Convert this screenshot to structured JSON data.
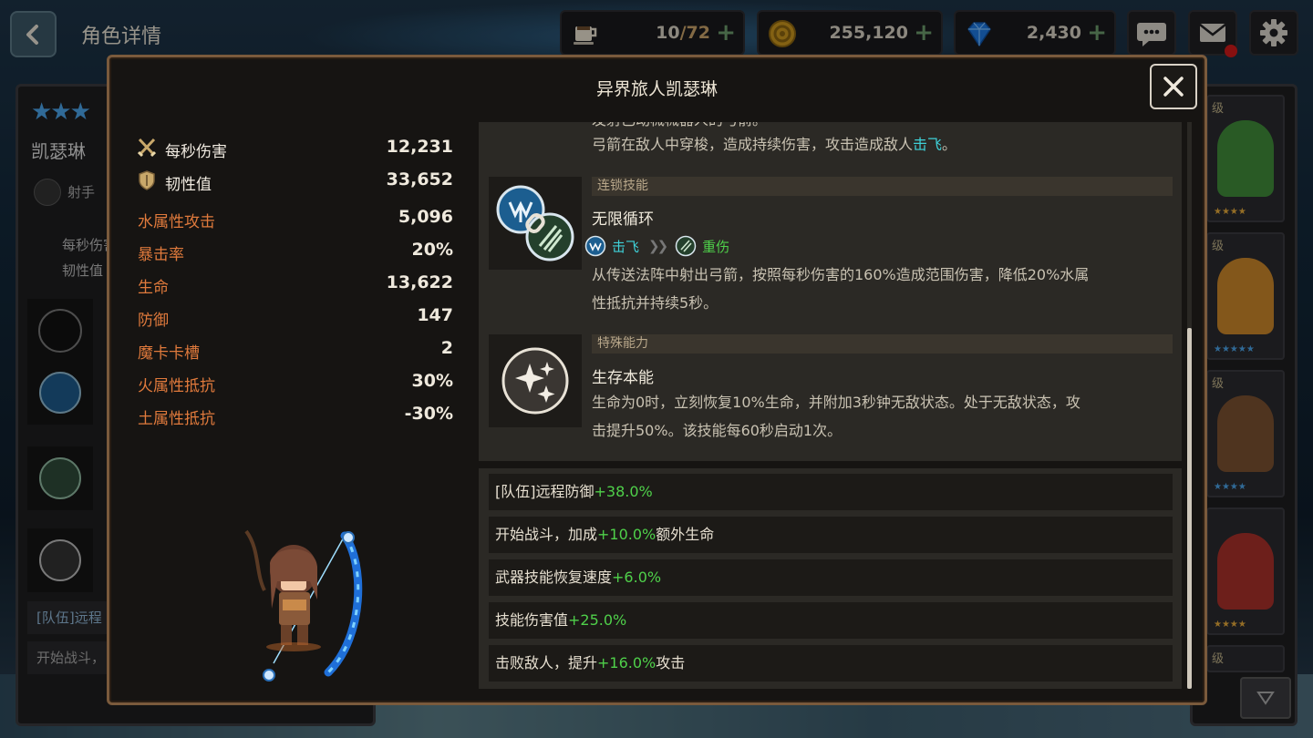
{
  "topbar": {
    "title": "角色详情",
    "stamina": {
      "current": "10",
      "max": "/72"
    },
    "gold": "255,120",
    "gems": "2,430"
  },
  "background_panel": {
    "hero_name": "凯瑟琳",
    "hero_class": "射手",
    "stat_dps_label": "每秒伤害",
    "stat_toughness_label": "韧性值",
    "buff_1": "[队伍]远程",
    "buff_2": "开始战斗，",
    "level_tag": "级"
  },
  "modal": {
    "title": "异界旅人凯瑟琳",
    "stats": [
      {
        "label": "每秒伤害",
        "value": "12,231",
        "style": "white",
        "icon": "crossed-swords-icon"
      },
      {
        "label": "韧性值",
        "value": "33,652",
        "style": "white",
        "icon": "shield-icon"
      },
      {
        "label": "水属性攻击",
        "value": "5,096",
        "style": "orange"
      },
      {
        "label": "暴击率",
        "value": "20%",
        "style": "orange"
      },
      {
        "label": "生命",
        "value": "13,622",
        "style": "orange"
      },
      {
        "label": "防御",
        "value": "147",
        "style": "orange"
      },
      {
        "label": "魔卡卡槽",
        "value": "2",
        "style": "orange"
      },
      {
        "label": "火属性抵抗",
        "value": "30%",
        "style": "orange"
      },
      {
        "label": "土属性抵抗",
        "value": "-30%",
        "style": "orange"
      }
    ],
    "skills": {
      "partial_top": "发射已动械械器人的弓箭。",
      "skill1_desc_pre": "弓箭在敌人中穿梭，造成持续伤害，攻击造成敌人",
      "skill1_desc_kw": "击飞",
      "skill1_desc_post": "。",
      "skill2_category": "连锁技能",
      "skill2_name": "无限循环",
      "skill2_chain_from": "击飞",
      "skill2_chain_to": "重伤",
      "skill2_desc_line1": "从传送法阵中射出弓箭，按照每秒伤害的160%造成范围伤害，降低20%水属",
      "skill2_desc_line2": "性抵抗并持续5秒。",
      "skill3_category": "特殊能力",
      "skill3_name": "生存本能",
      "skill3_desc_line1": "生命为0时，立刻恢复10%生命，并附加3秒钟无敌状态。处于无敌状态，攻",
      "skill3_desc_line2": "击提升50%。该技能每60秒启动1次。"
    },
    "buffs": [
      {
        "pre": "[队伍]远程防御",
        "val": "+38.0%",
        "post": ""
      },
      {
        "pre": "开始战斗，加成",
        "val": "+10.0%",
        "post": "额外生命"
      },
      {
        "pre": "武器技能恢复速度",
        "val": "+6.0%",
        "post": ""
      },
      {
        "pre": "技能伤害值",
        "val": "+25.0%",
        "post": ""
      },
      {
        "pre": "击败敌人，提升",
        "val": "+16.0%",
        "post": "攻击"
      }
    ]
  },
  "colors": {
    "stat_orange": "#e07a3c",
    "keyword_cyan": "#3fd1d8",
    "buff_green": "#4fd04a",
    "modal_border": "#7a5a3c"
  }
}
